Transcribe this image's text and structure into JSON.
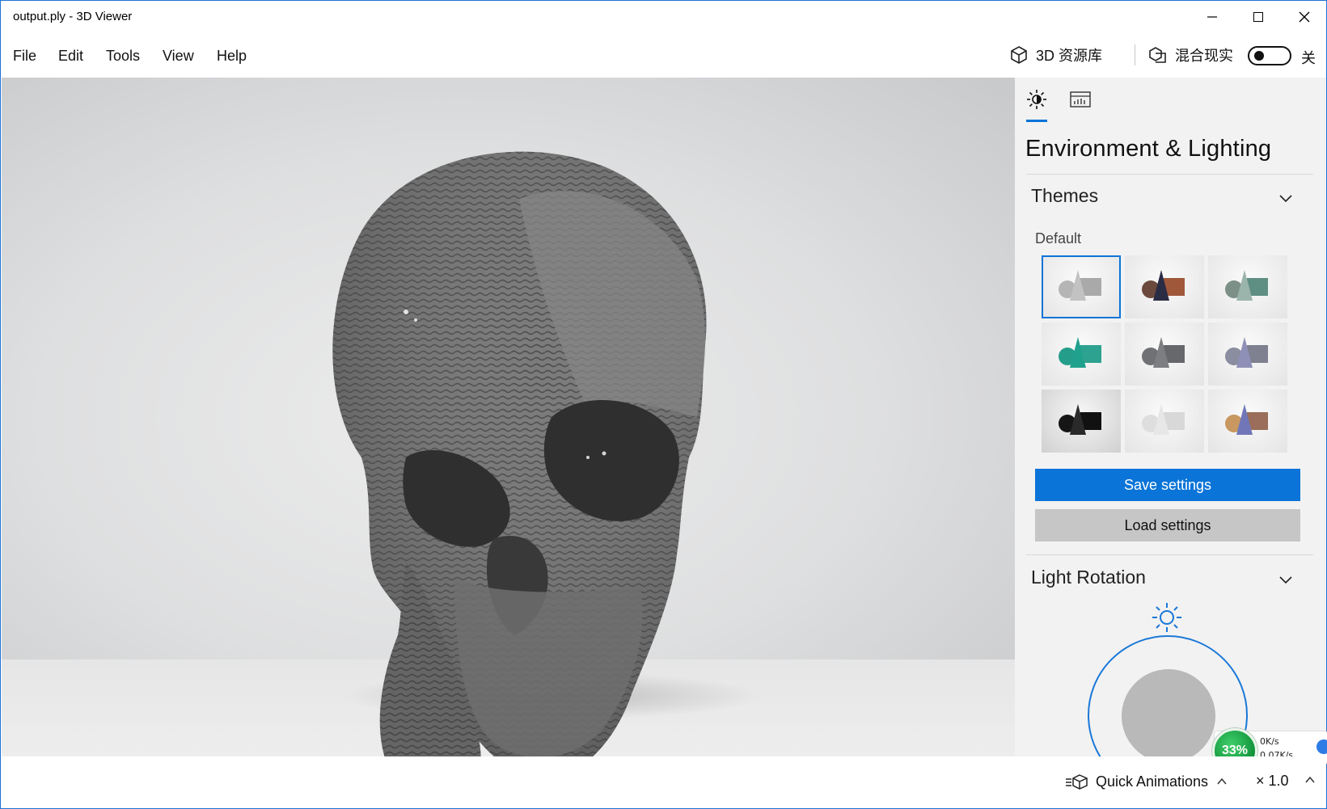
{
  "window": {
    "title": "output.ply - 3D Viewer",
    "minimize": "—",
    "close": "✕"
  },
  "menu": {
    "items": [
      "File",
      "Edit",
      "Tools",
      "View",
      "Help"
    ]
  },
  "toolbar": {
    "library_label": "3D 资源库",
    "mixed_reality_label": "混合现实",
    "mixed_reality_state": "关"
  },
  "viewport": {
    "model_icon": "skull-model"
  },
  "panel": {
    "tabs": [
      {
        "icon": "sun-icon",
        "selected": true
      },
      {
        "icon": "stats-icon",
        "selected": false
      }
    ],
    "title": "Environment & Lighting",
    "themes": {
      "heading": "Themes",
      "group_label": "Default",
      "tiles": [
        {
          "name": "default",
          "selected": true,
          "sphere": "#b5b5b5",
          "cone": "#c2c2c2",
          "box": "#a9a9a9",
          "bg": "light"
        },
        {
          "name": "dark-copper",
          "selected": false,
          "sphere": "#6b4a3d",
          "cone": "#2a2c44",
          "box": "#a0583b",
          "bg": "light"
        },
        {
          "name": "teal-grey",
          "selected": false,
          "sphere": "#7d9088",
          "cone": "#9bb5ac",
          "box": "#5f8f83",
          "bg": "light"
        },
        {
          "name": "teal",
          "selected": false,
          "sphere": "#249e8b",
          "cone": "#20a18e",
          "box": "#2ea290",
          "bg": "light"
        },
        {
          "name": "slate",
          "selected": false,
          "sphere": "#6f7174",
          "cone": "#7c7e82",
          "box": "#66686c",
          "bg": "light"
        },
        {
          "name": "lavender",
          "selected": false,
          "sphere": "#8b8da0",
          "cone": "#8f90b8",
          "box": "#7f8090",
          "bg": "light"
        },
        {
          "name": "black",
          "selected": false,
          "sphere": "#161616",
          "cone": "#2a2a2a",
          "box": "#111111",
          "bg": "dark"
        },
        {
          "name": "white",
          "selected": false,
          "sphere": "#dedede",
          "cone": "#e7e7e7",
          "box": "#d8d8d8",
          "bg": "light"
        },
        {
          "name": "warm",
          "selected": false,
          "sphere": "#c89860",
          "cone": "#7076b8",
          "box": "#9a6e5a",
          "bg": "light"
        }
      ]
    },
    "save_label": "Save settings",
    "load_label": "Load settings",
    "light_rotation": {
      "heading": "Light Rotation"
    }
  },
  "network": {
    "percent": "33%",
    "up": "0K/s",
    "down": "0.07K/s"
  },
  "status": {
    "quick_animations": "Quick Animations",
    "speed": "× 1.0"
  },
  "colors": {
    "accent": "#0a74d8",
    "panel_bg": "#f2f2f2",
    "secondary_btn": "#c6c6c6"
  }
}
